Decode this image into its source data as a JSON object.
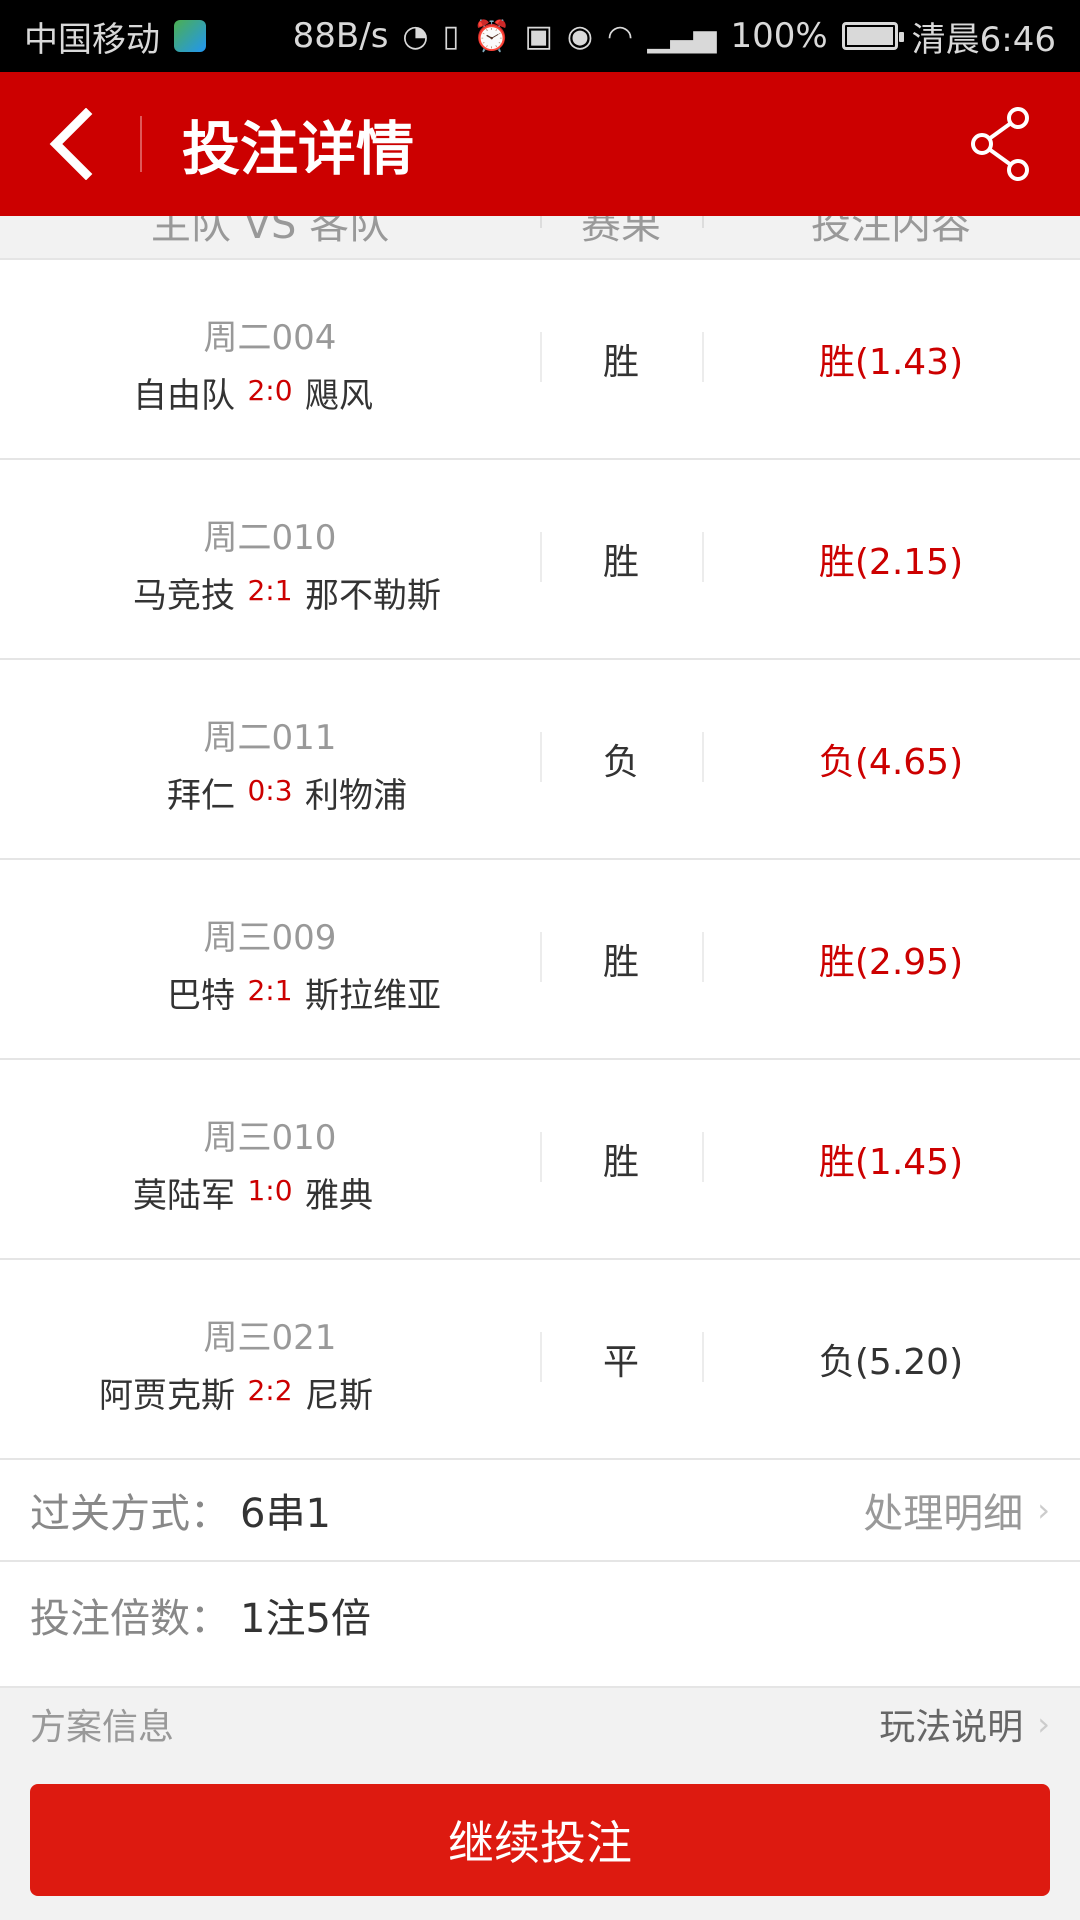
{
  "status_bar": {
    "carrier": "中国移动",
    "speed": "88B/s",
    "battery": "100%",
    "battery_level": 1.0,
    "time": "清晨6:46"
  },
  "header": {
    "title": "投注详情",
    "back_icon": "chevron-left-icon",
    "share_icon": "share-icon"
  },
  "table_header": {
    "teams": "主队 VS 客队",
    "result": "赛果",
    "bet": "投注内容"
  },
  "matches": [
    {
      "id": "周二004",
      "home": "自由队",
      "score": "2:0",
      "away": "飓风",
      "result": "胜",
      "bet": "胜(1.43)",
      "hit": true
    },
    {
      "id": "周二010",
      "home": "马竞技",
      "score": "2:1",
      "away": "那不勒斯",
      "result": "胜",
      "bet": "胜(2.15)",
      "hit": true
    },
    {
      "id": "周二011",
      "home": "拜仁",
      "score": "0:3",
      "away": "利物浦",
      "result": "负",
      "bet": "负(4.65)",
      "hit": true
    },
    {
      "id": "周三009",
      "home": "巴特",
      "score": "2:1",
      "away": "斯拉维亚",
      "result": "胜",
      "bet": "胜(2.95)",
      "hit": true
    },
    {
      "id": "周三010",
      "home": "莫陆军",
      "score": "1:0",
      "away": "雅典",
      "result": "胜",
      "bet": "胜(1.45)",
      "hit": true
    },
    {
      "id": "周三021",
      "home": "阿贾克斯",
      "score": "2:2",
      "away": "尼斯",
      "result": "平",
      "bet": "负(5.20)",
      "hit": false
    }
  ],
  "pass": {
    "label": "过关方式：",
    "value": "6串1",
    "link": "处理明细"
  },
  "multiplier": {
    "label": "投注倍数：",
    "value": "1注5倍"
  },
  "plan": {
    "title": "方案信息",
    "link": "玩法说明"
  },
  "colors": {
    "brand_red": "#cc0000",
    "button_red": "#dd1a10"
  },
  "action": {
    "continue_label": "继续投注"
  }
}
